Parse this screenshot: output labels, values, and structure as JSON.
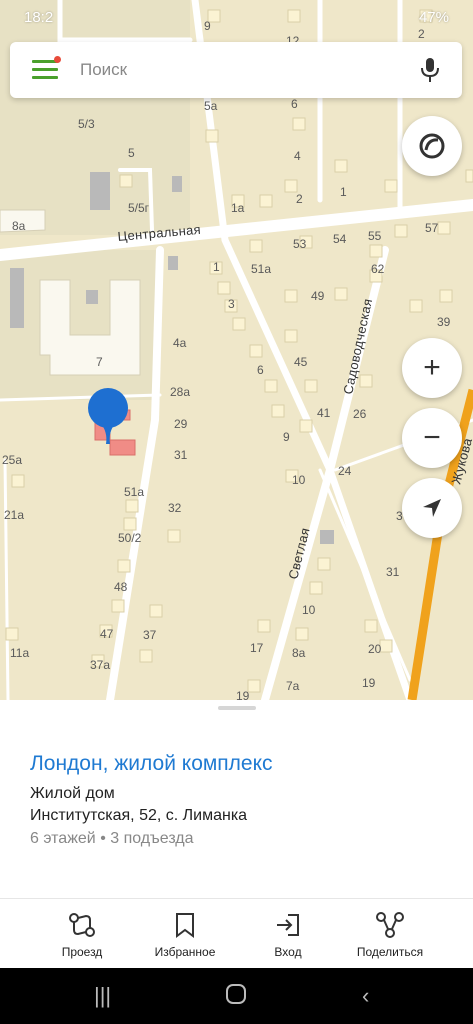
{
  "status_bar": {
    "time": "18:2",
    "battery": "47%"
  },
  "search": {
    "placeholder": "Поиск"
  },
  "map": {
    "streets": [
      "Центральная",
      "Садоводческая",
      "Светлая",
      "Жукова"
    ],
    "house_numbers": [
      "9",
      "12",
      "2",
      "5a",
      "6",
      "5/3",
      "5",
      "4",
      "5/5г",
      "8a",
      "1a",
      "2",
      "1",
      "7",
      "53",
      "54",
      "55",
      "57",
      "1",
      "51a",
      "62",
      "3",
      "49",
      "4a",
      "45",
      "39",
      "28a",
      "6",
      "29",
      "41",
      "26",
      "9",
      "31",
      "24",
      "32",
      "10",
      "51a",
      "50/2",
      "48",
      "37",
      "47",
      "37a",
      "25a",
      "21a",
      "11a",
      "17",
      "8a",
      "10",
      "20",
      "19",
      "7a",
      "19",
      "31",
      "3"
    ]
  },
  "place": {
    "title": "Лондон, жилой комплекс",
    "type": "Жилой дом",
    "address": "Институтская, 52, с. Лиманка",
    "details": "6 этажей • 3 подъезда"
  },
  "actions": {
    "route": "Проезд",
    "favorites": "Избранное",
    "entrance": "Вход",
    "share": "Поделиться"
  },
  "colors": {
    "accent": "#1f7ad2",
    "menu_green": "#4aa02c",
    "pin_blue": "#1e6fd1",
    "highway": "#f0a21c"
  }
}
